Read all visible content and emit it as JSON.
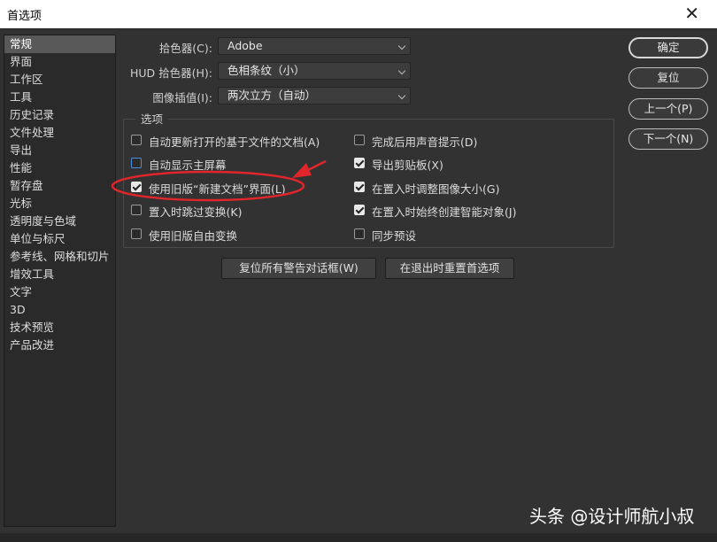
{
  "window": {
    "title": "首选项",
    "close_glyph": "✕"
  },
  "sidebar": {
    "items": [
      {
        "label": "常规"
      },
      {
        "label": "界面"
      },
      {
        "label": "工作区"
      },
      {
        "label": "工具"
      },
      {
        "label": "历史记录"
      },
      {
        "label": "文件处理"
      },
      {
        "label": "导出"
      },
      {
        "label": "性能"
      },
      {
        "label": "暂存盘"
      },
      {
        "label": "光标"
      },
      {
        "label": "透明度与色域"
      },
      {
        "label": "单位与标尺"
      },
      {
        "label": "参考线、网格和切片"
      },
      {
        "label": "增效工具"
      },
      {
        "label": "文字"
      },
      {
        "label": "3D"
      },
      {
        "label": "技术预览"
      },
      {
        "label": "产品改进"
      }
    ],
    "selected": "常规"
  },
  "fields": {
    "color_picker": {
      "label": "拾色器(C):",
      "value": "Adobe"
    },
    "hud_picker": {
      "label": "HUD 拾色器(H):",
      "value": "色相条纹（小）"
    },
    "interpolation": {
      "label": "图像插值(I):",
      "value": "两次立方（自动）"
    }
  },
  "options": {
    "title": "选项",
    "left": [
      {
        "label": "自动更新打开的基于文件的文档(A)",
        "checked": false
      },
      {
        "label": "自动显示主屏幕",
        "checked": false
      },
      {
        "label": "使用旧版“新建文档”界面(L)",
        "checked": true
      },
      {
        "label": "置入时跳过变换(K)",
        "checked": false
      },
      {
        "label": "使用旧版自由变换",
        "checked": false
      }
    ],
    "right": [
      {
        "label": "完成后用声音提示(D)",
        "checked": false
      },
      {
        "label": "导出剪贴板(X)",
        "checked": true
      },
      {
        "label": "在置入时调整图像大小(G)",
        "checked": true
      },
      {
        "label": "在置入时始终创建智能对象(J)",
        "checked": true
      },
      {
        "label": "同步预设",
        "checked": false
      }
    ]
  },
  "reset_buttons": {
    "reset_warnings": "复位所有警告对话框(W)",
    "reset_on_quit": "在退出时重置首选项"
  },
  "dialog_buttons": {
    "ok": "确定",
    "reset": "复位",
    "prev": "上一个(P)",
    "next": "下一个(N)"
  },
  "annotation_color": "#e0262b",
  "watermark": "头条 @设计师航小叔"
}
